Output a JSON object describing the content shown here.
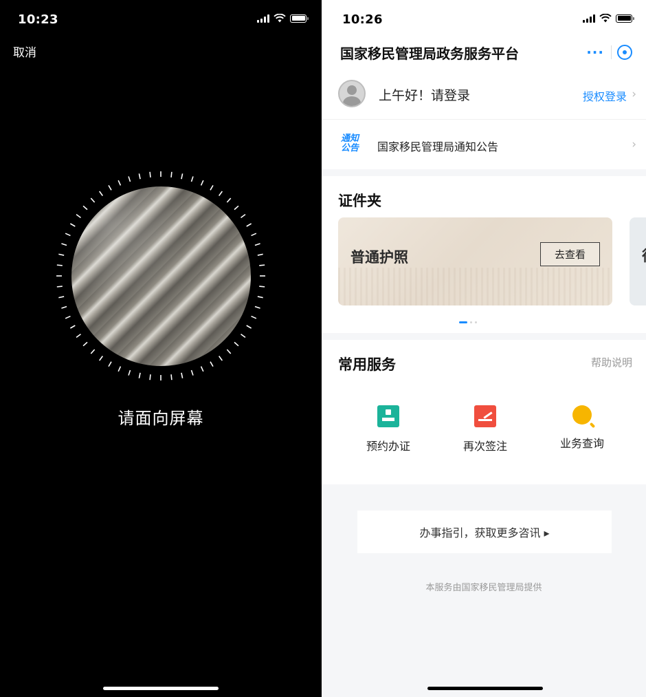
{
  "left": {
    "status": {
      "time": "10:23"
    },
    "cancel_label": "取消",
    "prompt": "请面向屏幕"
  },
  "right": {
    "status": {
      "time": "10:26"
    },
    "header": {
      "title": "国家移民管理局政务服务平台"
    },
    "login": {
      "greeting": "上午好！请登录",
      "auth_link": "授权登录"
    },
    "notice": {
      "badge_line1": "通知",
      "badge_line2": "公告",
      "text": "国家移民管理局通知公告"
    },
    "cards": {
      "title": "证件夹",
      "items": [
        {
          "label": "普通护照",
          "button": "去查看"
        },
        {
          "label": "往"
        }
      ]
    },
    "services": {
      "title": "常用服务",
      "help": "帮助说明",
      "items": [
        {
          "label": "预约办证",
          "icon": "id-card-icon",
          "color": "#1bb39a"
        },
        {
          "label": "再次签注",
          "icon": "sign-pen-icon",
          "color": "#f04e3e"
        },
        {
          "label": "业务查询",
          "icon": "search-icon",
          "color": "#f7b500"
        }
      ]
    },
    "guide": "办事指引，获取更多咨讯 ▸",
    "footer": "本服务由国家移民管理局提供"
  },
  "colors": {
    "accent": "#1a8cff"
  }
}
